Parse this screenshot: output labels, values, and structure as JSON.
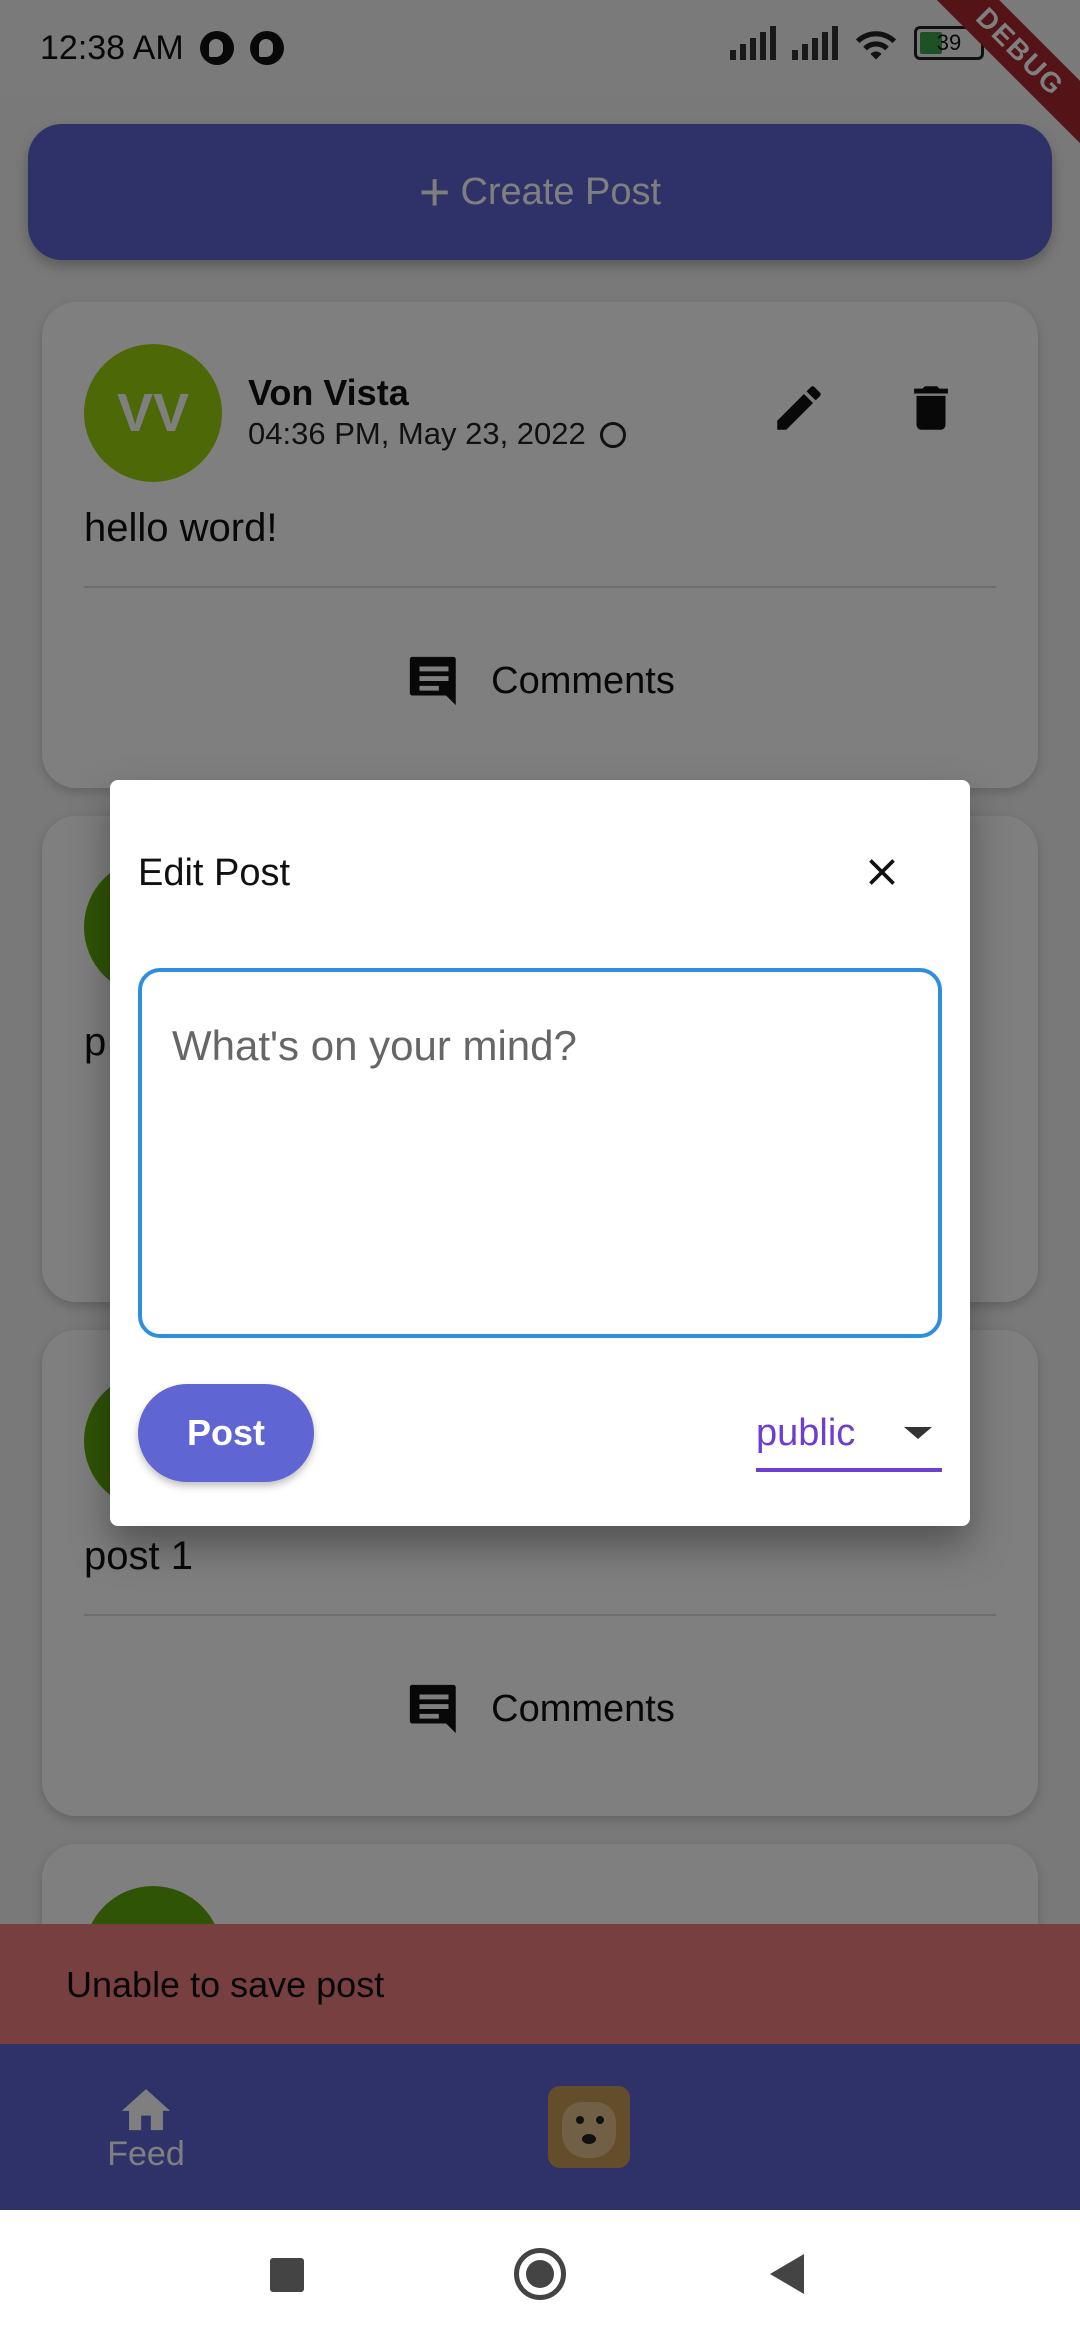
{
  "status_bar": {
    "time": "12:38 AM",
    "battery": "39",
    "debug_badge": "DEBUG"
  },
  "create_post_label": "Create Post",
  "posts": [
    {
      "initials": "VV",
      "author": "Von Vista",
      "timestamp": "04:36 PM, May 23, 2022",
      "body": "hello word!",
      "comments_label": "Comments"
    },
    {
      "body_prefix": "p"
    },
    {
      "body": "post 1",
      "comments_label": "Comments"
    }
  ],
  "dialog": {
    "title": "Edit Post",
    "placeholder": "What's on your mind?",
    "post_button": "Post",
    "privacy_selected": "public"
  },
  "snackbar": {
    "message": "Unable to save post"
  },
  "bottom_nav": {
    "feed_label": "Feed"
  },
  "colors": {
    "accent": "#5f65d3",
    "avatar_primary": "#9bd10f",
    "avatar_secondary": "#5fa80c",
    "snackbar_bg": "#ef7f7f",
    "input_border": "#2e8fe0",
    "dropdown_underline": "#6c3fd0"
  }
}
